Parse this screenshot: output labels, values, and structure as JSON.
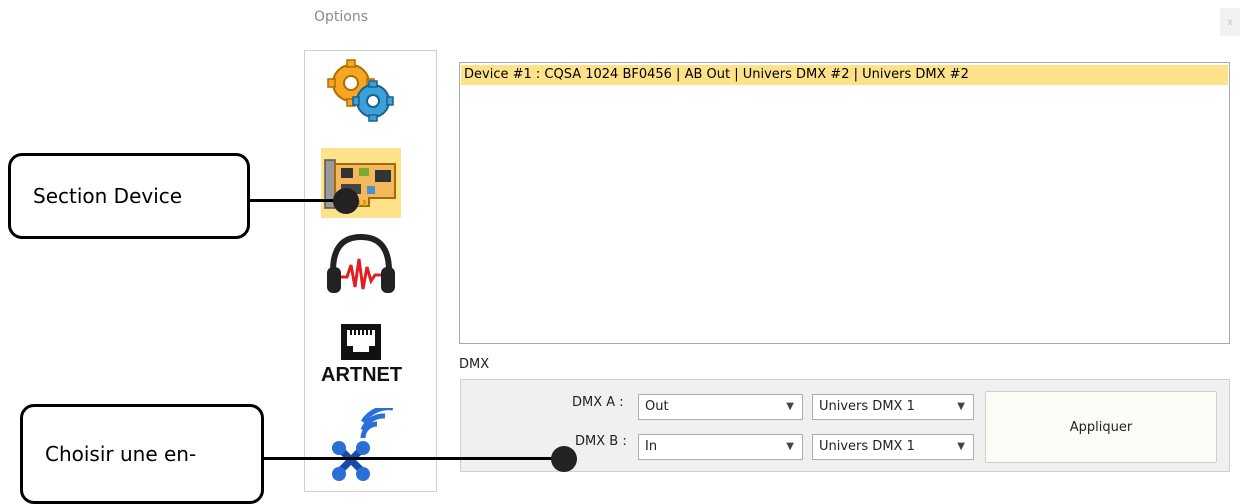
{
  "window": {
    "title": "Options",
    "close_label": "x"
  },
  "sidebar": {
    "items": [
      {
        "name": "settings",
        "icon": "gears-icon"
      },
      {
        "name": "device",
        "icon": "circuit-board-icon",
        "selected": true
      },
      {
        "name": "audio",
        "icon": "headphones-icon"
      },
      {
        "name": "artnet",
        "icon": "ethernet-port-icon",
        "label": "ARTNET"
      },
      {
        "name": "network",
        "icon": "wireless-network-icon"
      }
    ]
  },
  "device_list": {
    "rows": [
      "Device #1 : CQSA 1024 BF0456 | AB Out | Univers DMX #2 | Univers DMX #2"
    ]
  },
  "dmx": {
    "title": "DMX",
    "a": {
      "label": "DMX A :",
      "mode": "Out",
      "universe": "Univers DMX 1"
    },
    "b": {
      "label": "DMX B :",
      "mode": "In",
      "universe": "Univers DMX 1"
    },
    "apply_label": "Appliquer"
  },
  "callouts": {
    "device": "Section Device",
    "choose": "Choisir une en-"
  },
  "colors": {
    "selected": "#fde28a",
    "accent_orange": "#f5a623",
    "accent_blue": "#3aa0d8"
  }
}
